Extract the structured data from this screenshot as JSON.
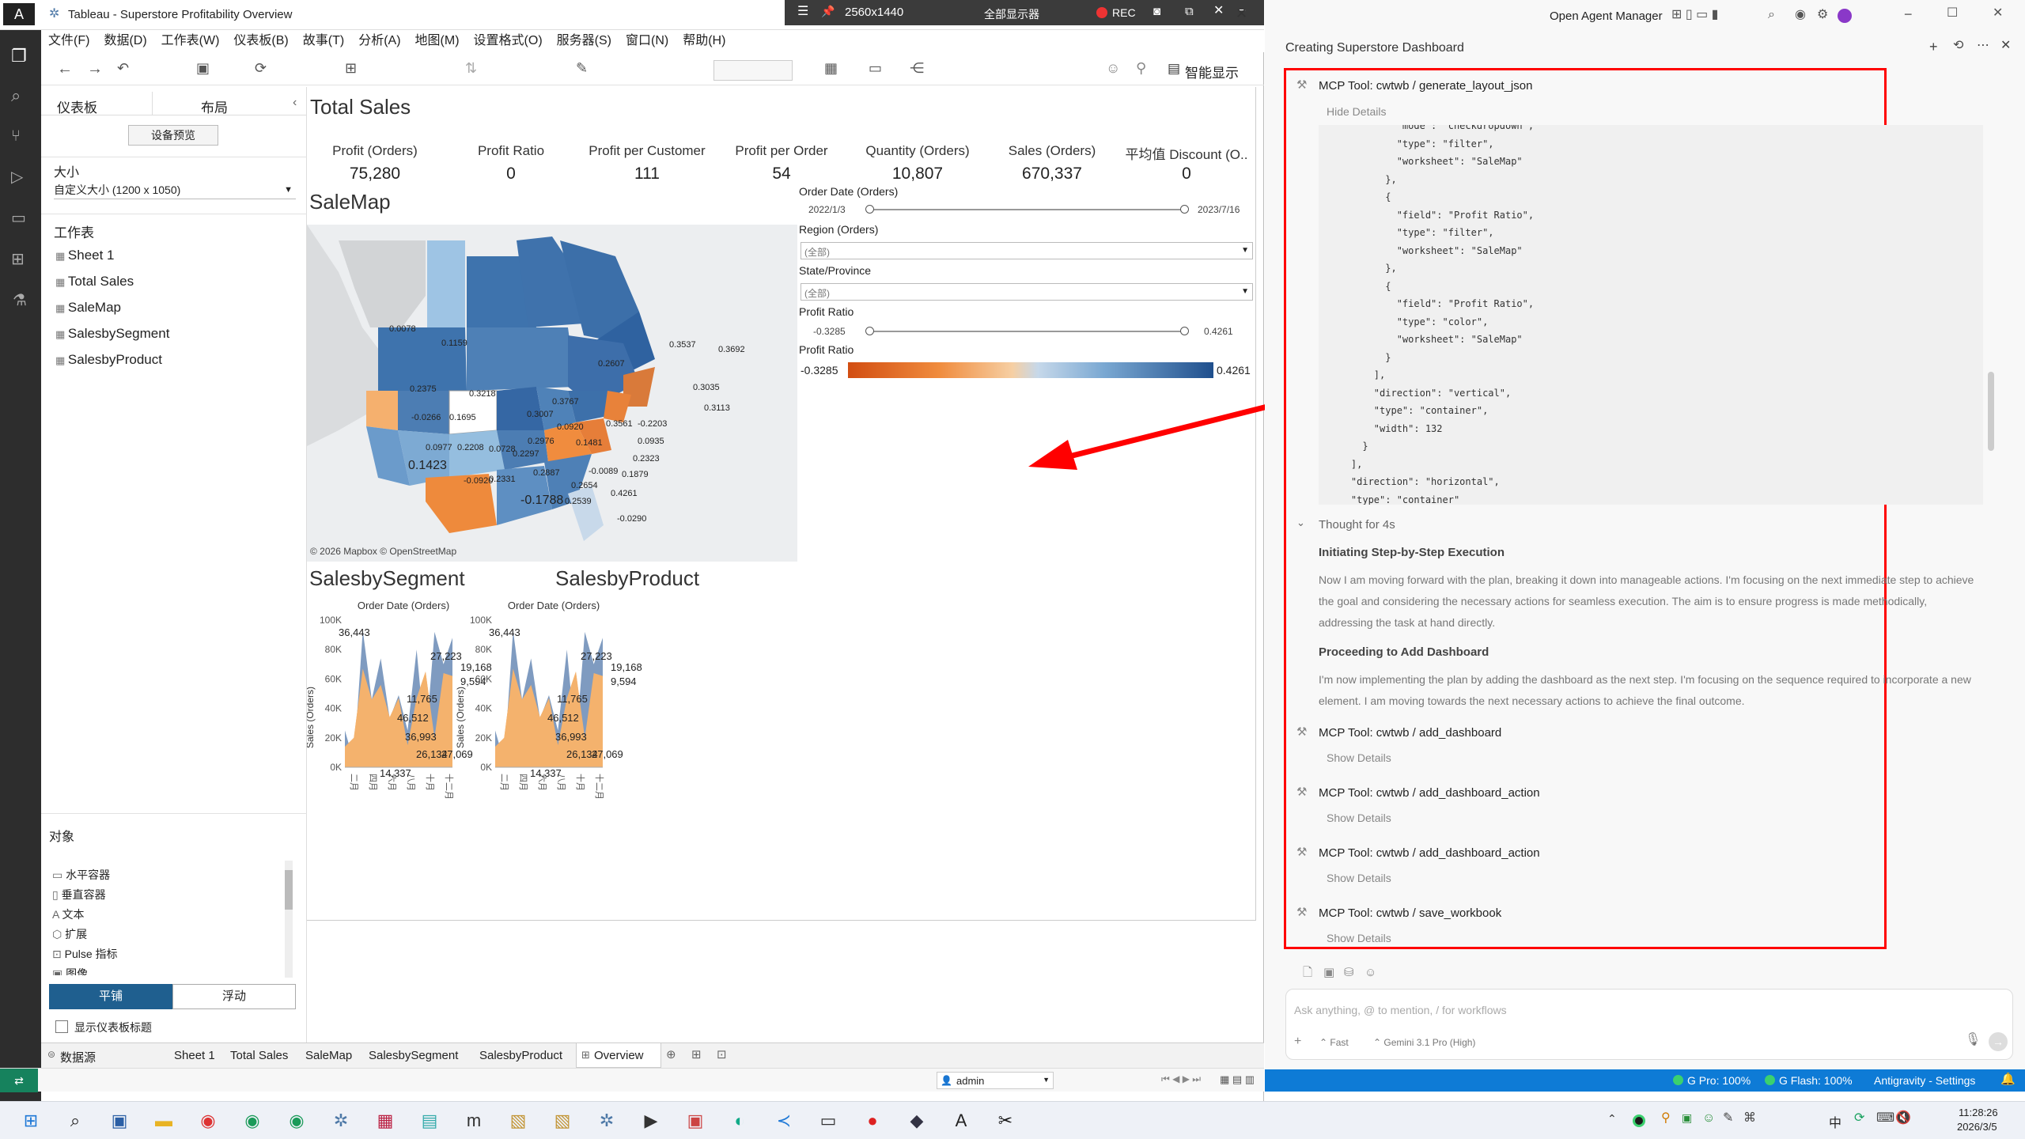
{
  "tableau": {
    "title": "Tableau - Superstore Profitability Overview",
    "rec": {
      "size": "2560x1440",
      "display": "全部显示器",
      "rec": "REC"
    },
    "menu": [
      "文件(F)",
      "数据(D)",
      "工作表(W)",
      "仪表板(B)",
      "故事(T)",
      "分析(A)",
      "地图(M)",
      "设置格式(O)",
      "服务器(S)",
      "窗口(N)",
      "帮助(H)"
    ],
    "smart_show": "智能显示",
    "side": {
      "tab_dashboard": "仪表板",
      "tab_layout": "布局",
      "device_preview": "设备预览",
      "size_label": "大小",
      "size_value": "自定义大小 (1200 x 1050)",
      "sheets_label": "工作表",
      "sheets": [
        "Sheet 1",
        "Total Sales",
        "SaleMap",
        "SalesbySegment",
        "SalesbyProduct"
      ],
      "objects_label": "对象",
      "objects": [
        "水平容器",
        "垂直容器",
        "文本",
        "扩展",
        "Pulse 指标",
        "图像"
      ],
      "tiled": "平铺",
      "floating": "浮动",
      "show_title": "显示仪表板标题"
    },
    "total_sales": {
      "title": "Total Sales",
      "kpis": [
        {
          "label": "Profit (Orders)",
          "value": "75,280"
        },
        {
          "label": "Profit Ratio",
          "value": "0"
        },
        {
          "label": "Profit per Customer",
          "value": "111"
        },
        {
          "label": "Profit per Order",
          "value": "54"
        },
        {
          "label": "Quantity (Orders)",
          "value": "10,807"
        },
        {
          "label": "Sales (Orders)",
          "value": "670,337"
        },
        {
          "label": "平均值 Discount (O..",
          "value": "0"
        }
      ]
    },
    "salemap": {
      "title": "SaleMap",
      "credit": "© 2026 Mapbox © OpenStreetMap",
      "labels": [
        "0.0078",
        "0.1159",
        "0.2607",
        "0.3537",
        "0.3692",
        "0.2375",
        "0.3218",
        "0.3767",
        "0.3007",
        "0.0920",
        "0.2976",
        "0.1695",
        "-0.0266",
        "0.0977",
        "0.2208",
        "0.0728",
        "0.2297",
        "0.1481",
        "-0.2203",
        "0.0935",
        "0.3035",
        "0.3113",
        "0.1423",
        "-0.0920",
        "0.2331",
        "0.2887",
        "-0.0089",
        "0.1879",
        "0.2323",
        "0.3561",
        "-0.1788",
        "0.2654",
        "0.2539",
        "0.4261",
        "-0.0290"
      ]
    },
    "filters": {
      "order_date_label": "Order Date (Orders)",
      "date_min": "2022/1/3",
      "date_max": "2023/7/16",
      "region_label": "Region (Orders)",
      "region_value": "(全部)",
      "state_label": "State/Province",
      "state_value": "(全部)",
      "ratio_label": "Profit Ratio",
      "ratio_min": "-0.3285",
      "ratio_max": "0.4261",
      "legend_label": "Profit Ratio",
      "legend_min": "-0.3285",
      "legend_max": "0.4261"
    },
    "sheet_tabs": [
      "数据源",
      "Sheet 1",
      "Total Sales",
      "SaleMap",
      "SalesbySegment",
      "SalesbyProduct",
      "Overview"
    ],
    "status_user": "admin"
  },
  "chart_data": [
    {
      "type": "area",
      "title": "SalesbySegment",
      "xlabel": "Order Date (Orders)",
      "ylabel": "Sales (Orders)",
      "categories": [
        "二月",
        "四月",
        "六月",
        "八月",
        "十月",
        "十二月"
      ],
      "ylim": [
        0,
        100000
      ],
      "yticks": [
        "0K",
        "20K",
        "40K",
        "60K",
        "80K",
        "100K"
      ],
      "series": [
        {
          "values": [
            14000,
            20000,
            67000,
            46000,
            56000,
            34000,
            47000,
            15000,
            47000,
            65000,
            20000,
            64000,
            62000
          ],
          "color": "#f4b26d"
        },
        {
          "values": [
            25000,
            4000,
            93000,
            46000,
            74000,
            33000,
            49000,
            25000,
            80000,
            15000,
            92000,
            70000,
            88000
          ],
          "color": "#7896bd"
        }
      ],
      "labels": [
        "36,443",
        "27,223",
        "19,168",
        "9,594",
        "11,765",
        "46,512",
        "36,993",
        "26,134",
        "27,069",
        "14,337"
      ]
    },
    {
      "type": "area",
      "title": "SalesbyProduct",
      "xlabel": "Order Date (Orders)",
      "ylabel": "Sales (Orders)",
      "categories": [
        "二月",
        "四月",
        "六月",
        "八月",
        "十月",
        "十二月"
      ],
      "ylim": [
        0,
        100000
      ],
      "yticks": [
        "0K",
        "20K",
        "40K",
        "60K",
        "80K",
        "100K"
      ],
      "series": [
        {
          "values": [
            14000,
            20000,
            67000,
            46000,
            56000,
            34000,
            47000,
            15000,
            47000,
            65000,
            20000,
            64000,
            62000
          ],
          "color": "#f4b26d"
        },
        {
          "values": [
            25000,
            4000,
            93000,
            46000,
            74000,
            33000,
            49000,
            25000,
            80000,
            15000,
            92000,
            70000,
            88000
          ],
          "color": "#7896bd"
        }
      ],
      "labels": [
        "36,443",
        "27,223",
        "19,168",
        "9,594",
        "11,765",
        "46,512",
        "36,993",
        "26,134",
        "27,069",
        "14,337"
      ]
    }
  ],
  "agent": {
    "app": "Open Agent Manager",
    "heading": "Creating Superstore Dashboard",
    "tool1": "MCP Tool: cwtwb / generate_layout_json",
    "hide_details": "Hide Details",
    "code": [
      "            \"mode\": \"checkdropdown\",",
      "            \"type\": \"filter\",",
      "            \"worksheet\": \"SaleMap\"",
      "          },",
      "          {",
      "            \"field\": \"Profit Ratio\",",
      "            \"type\": \"filter\",",
      "            \"worksheet\": \"SaleMap\"",
      "          },",
      "          {",
      "            \"field\": \"Profit Ratio\",",
      "            \"type\": \"color\",",
      "            \"worksheet\": \"SaleMap\"",
      "          }",
      "        ],",
      "        \"direction\": \"vertical\",",
      "        \"type\": \"container\",",
      "        \"width\": 132",
      "      }",
      "    ],",
      "    \"direction\": \"horizontal\",",
      "    \"type\": \"container\""
    ],
    "thought": "Thought for 4s",
    "h1": "Initiating Step-by-Step Execution",
    "p1": "Now I am moving forward with the plan, breaking it down into manageable actions. I'm focusing on the next immediate step to achieve the goal and considering the necessary actions for seamless execution. The aim is to ensure progress is made methodically, addressing the task at hand directly.",
    "h2": "Proceeding to Add Dashboard",
    "p2": "I'm now implementing the plan by adding the dashboard as the next step. I'm focusing on the sequence required to incorporate a new element. I am moving towards the next necessary actions to achieve the final outcome.",
    "tools": [
      "MCP Tool: cwtwb / add_dashboard",
      "MCP Tool: cwtwb / add_dashboard_action",
      "MCP Tool: cwtwb / add_dashboard_action",
      "MCP Tool: cwtwb / save_workbook"
    ],
    "show_details": "Show Details",
    "input_placeholder": "Ask anything, @ to mention, / for workflows",
    "mode": "Fast",
    "model": "Gemini 3.1 Pro (High)",
    "status": {
      "gpro": "G Pro: 100%",
      "gflash": "G Flash: 100%",
      "settings": "Antigravity - Settings"
    }
  },
  "taskbar": {
    "time": "11:28:26",
    "date": "2026/3/5",
    "ime": "中"
  },
  "colors": {
    "annot": "#ff0000",
    "blue": "#4e79a7",
    "orange": "#f28e2b",
    "accent": "#0e7bd6"
  }
}
